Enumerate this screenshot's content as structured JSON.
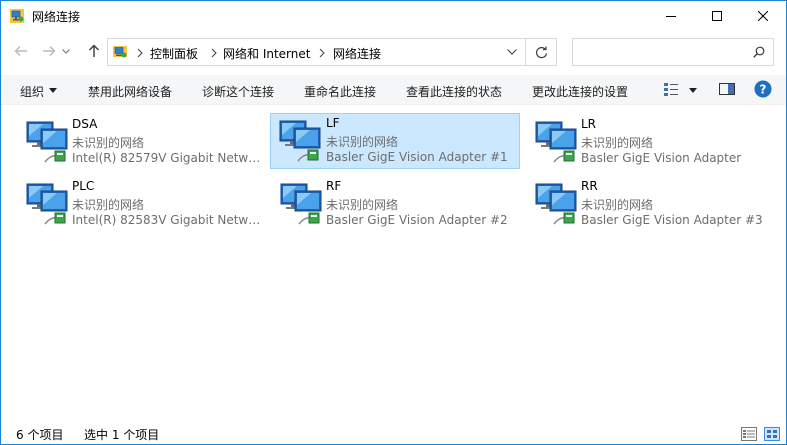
{
  "window": {
    "title": "网络连接"
  },
  "address": {
    "crumbs": [
      "控制面板",
      "网络和 Internet",
      "网络连接"
    ]
  },
  "search": {
    "placeholder": "",
    "value": ""
  },
  "toolbar": {
    "organize": "组织",
    "disable": "禁用此网络设备",
    "diagnose": "诊断这个连接",
    "rename": "重命名此连接",
    "status": "查看此连接的状态",
    "change": "更改此连接的设置"
  },
  "connections": [
    {
      "name": "DSA",
      "status": "未识别的网络",
      "adapter": "Intel(R) 82579V Gigabit Netwo..."
    },
    {
      "name": "LF",
      "status": "未识别的网络",
      "adapter": "Basler GigE Vision Adapter #1"
    },
    {
      "name": "LR",
      "status": "未识别的网络",
      "adapter": "Basler GigE Vision Adapter"
    },
    {
      "name": "PLC",
      "status": "未识别的网络",
      "adapter": "Intel(R) 82583V Gigabit Netwo..."
    },
    {
      "name": "RF",
      "status": "未识别的网络",
      "adapter": "Basler GigE Vision Adapter #2"
    },
    {
      "name": "RR",
      "status": "未识别的网络",
      "adapter": "Basler GigE Vision Adapter #3"
    }
  ],
  "statusbar": {
    "count": "6 个项目",
    "selected": "选中 1 个项目"
  },
  "colors": {
    "accent": "#1883d7",
    "selection_bg": "#cce8ff",
    "selection_border": "#99d1ff",
    "help": "#1e6fbf"
  }
}
